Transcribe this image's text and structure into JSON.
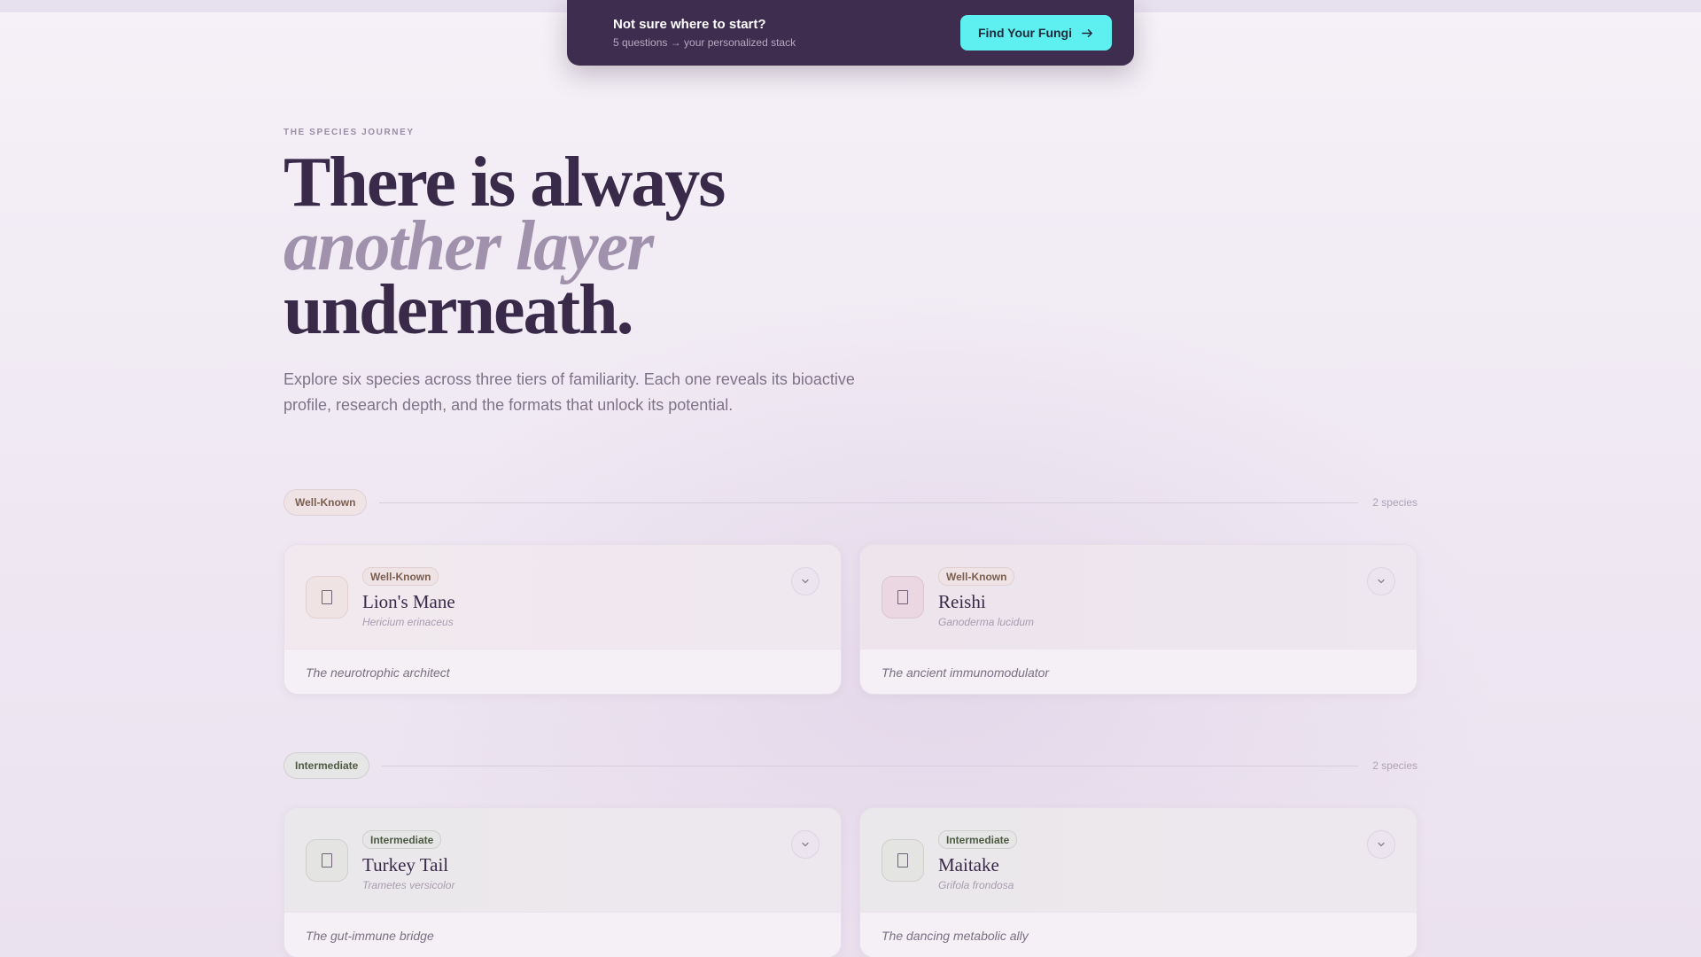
{
  "banner": {
    "title": "Not sure where to start?",
    "subtitle": "5 questions → your personalized stack",
    "button_label": "Find Your Fungi"
  },
  "hero": {
    "eyebrow": "THE SPECIES JOURNEY",
    "line1": "There is always",
    "line2": "another layer",
    "line3": "underneath.",
    "intro_line1": "Explore six species across three tiers of familiarity. Each one reveals its bioactive",
    "intro_line2": "profile, research depth, and the formats that unlock its potential."
  },
  "tiers": [
    {
      "label": "Well-Known",
      "count": "2 species",
      "cards": [
        {
          "badge": "Well-Known",
          "name": "Lion's Mane",
          "latin": "Hericium erinaceus",
          "tagline": "The neurotrophic architect"
        },
        {
          "badge": "Well-Known",
          "name": "Reishi",
          "latin": "Ganoderma lucidum",
          "tagline": "The ancient immunomodulator"
        }
      ]
    },
    {
      "label": "Intermediate",
      "count": "2 species",
      "cards": [
        {
          "badge": "Intermediate",
          "name": "Turkey Tail",
          "latin": "Trametes versicolor",
          "tagline": "The gut-immune bridge"
        },
        {
          "badge": "Intermediate",
          "name": "Maitake",
          "latin": "Grifola frondosa",
          "tagline": "The dancing metabolic ally"
        }
      ]
    }
  ],
  "icons": {
    "banner_button": "arrow-right-icon",
    "card_expand": "chevron-down-icon",
    "species": "mushroom-glyph-icon"
  },
  "colors": {
    "banner_bg": "#3f2d4f",
    "cta_accent": "#5ef0f0",
    "heading": "#3a2a4a",
    "heading_italic": "#a092ad"
  }
}
